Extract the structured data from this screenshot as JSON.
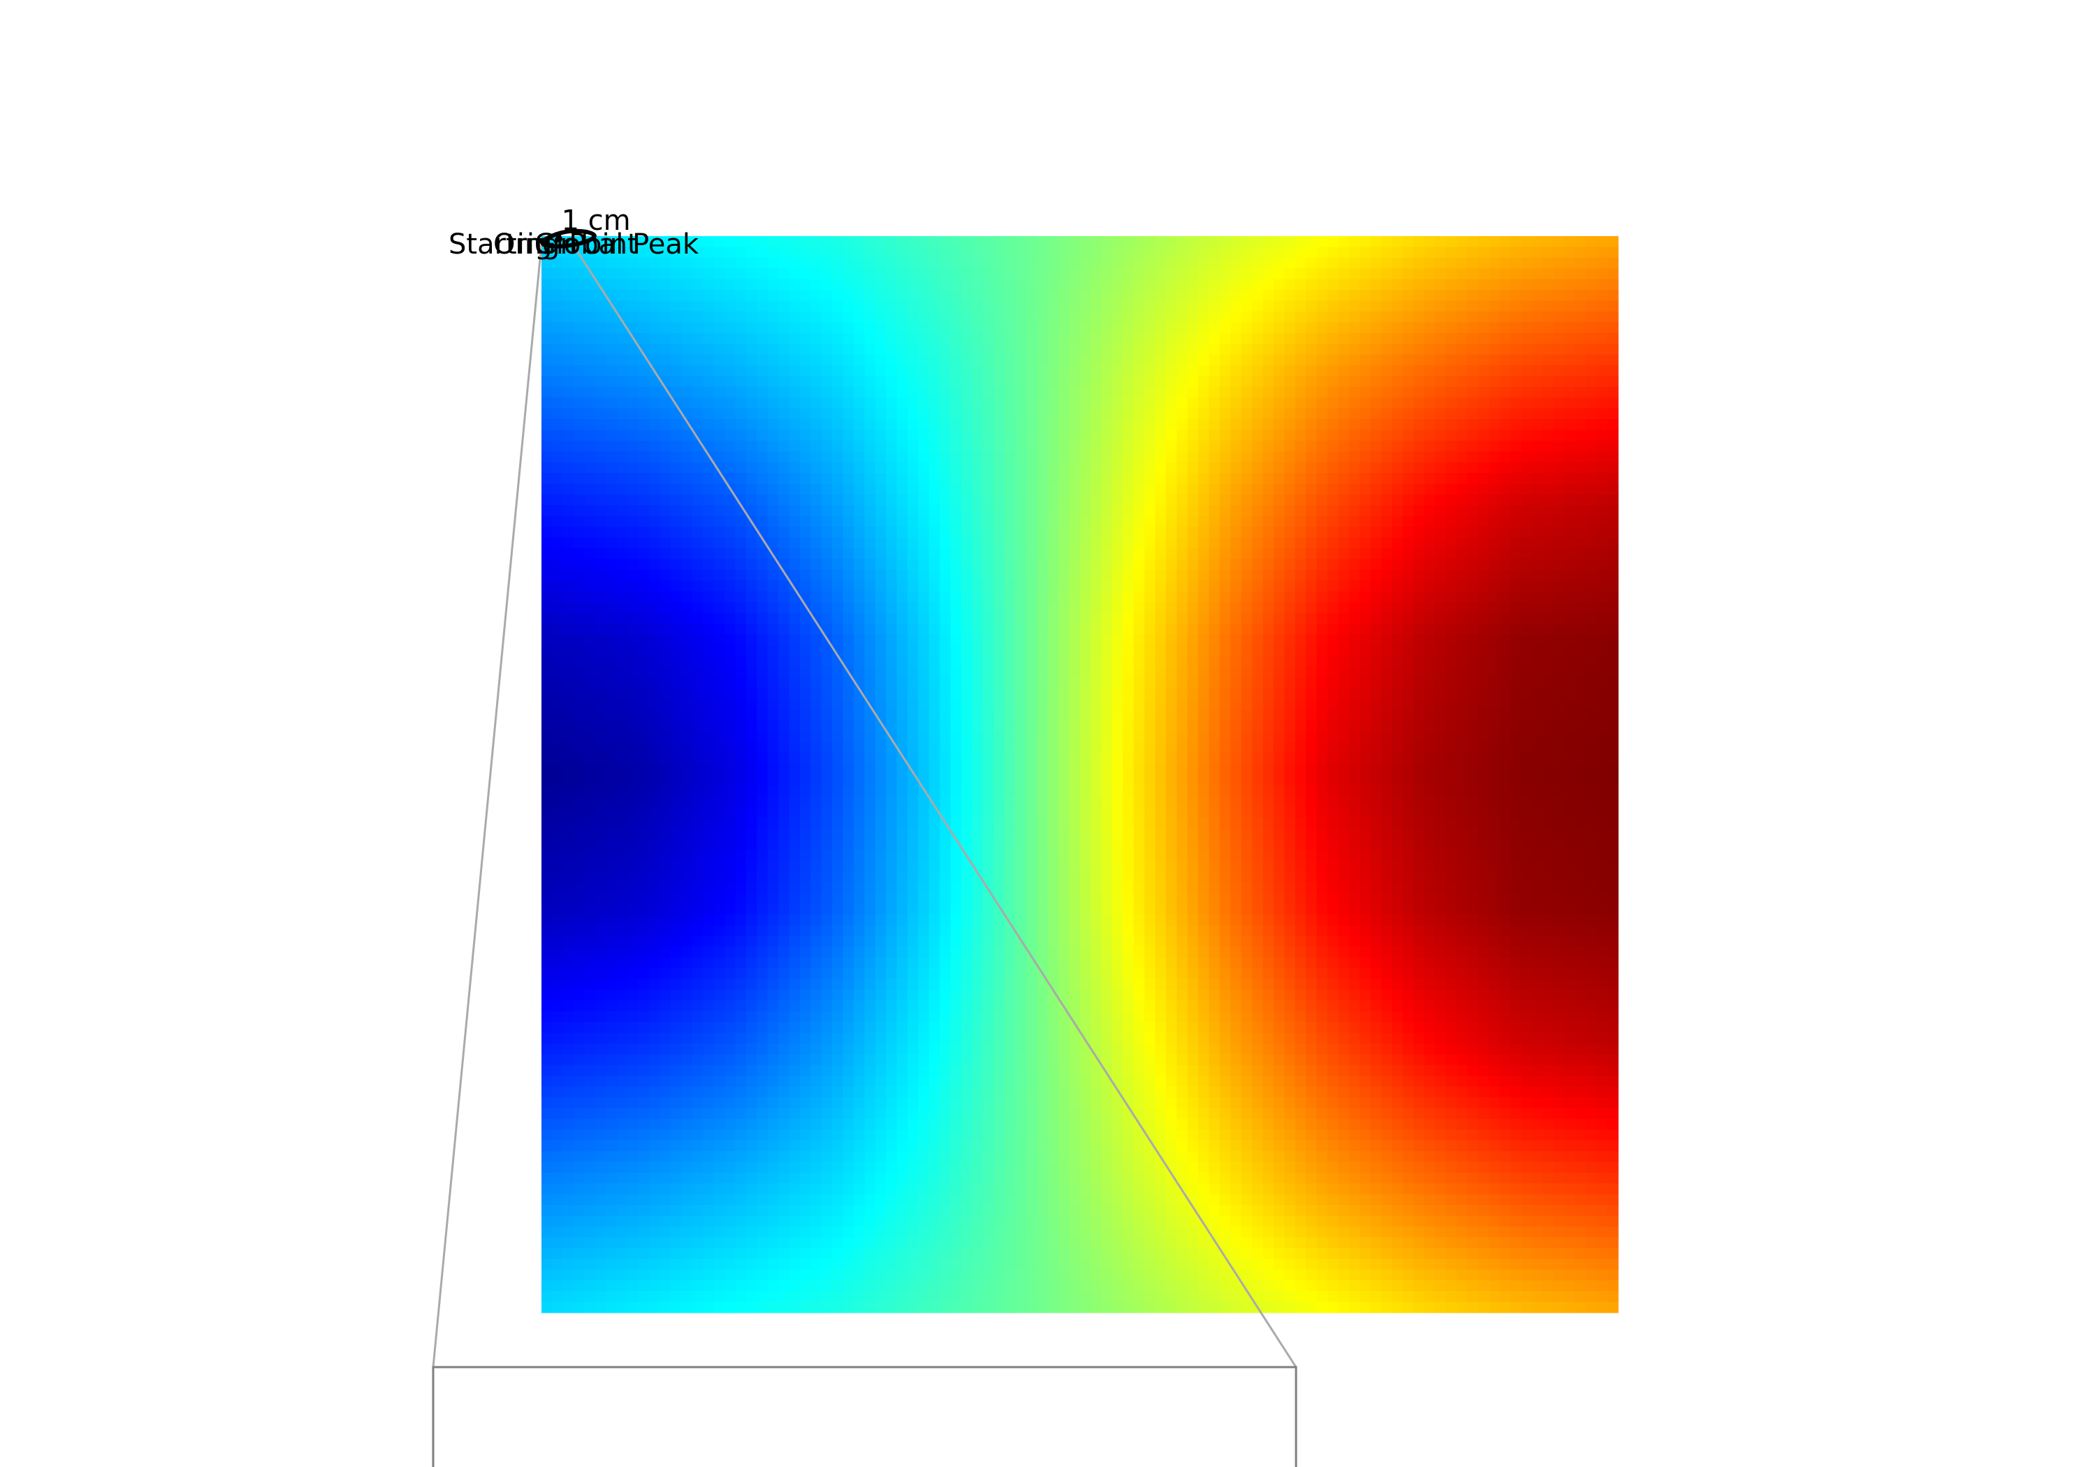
{
  "chart_data": {
    "type": "heatmap",
    "colormap": "jet",
    "grid": false,
    "axes_visible": false,
    "field": {
      "description_of_values": "normalized heatmap intensity in colormap units, 0 = dark blue, 1 = dark red",
      "samples": [
        [
          0.34,
          0.36,
          0.38,
          0.4,
          0.44,
          0.48,
          0.53,
          0.58,
          0.62,
          0.66,
          0.69,
          0.71
        ],
        [
          0.25,
          0.27,
          0.3,
          0.34,
          0.4,
          0.48,
          0.57,
          0.65,
          0.72,
          0.77,
          0.81,
          0.83
        ],
        [
          0.15,
          0.17,
          0.21,
          0.28,
          0.37,
          0.48,
          0.6,
          0.71,
          0.8,
          0.87,
          0.92,
          0.94
        ],
        [
          0.06,
          0.08,
          0.13,
          0.22,
          0.34,
          0.48,
          0.63,
          0.76,
          0.87,
          0.94,
          0.98,
          0.99
        ],
        [
          0.02,
          0.04,
          0.1,
          0.2,
          0.33,
          0.48,
          0.64,
          0.78,
          0.9,
          0.96,
          0.99,
          1.0
        ],
        [
          0.06,
          0.08,
          0.13,
          0.22,
          0.34,
          0.48,
          0.63,
          0.76,
          0.87,
          0.94,
          0.98,
          0.99
        ],
        [
          0.15,
          0.17,
          0.21,
          0.28,
          0.37,
          0.48,
          0.6,
          0.71,
          0.8,
          0.87,
          0.92,
          0.94
        ],
        [
          0.25,
          0.27,
          0.3,
          0.34,
          0.4,
          0.48,
          0.57,
          0.65,
          0.72,
          0.77,
          0.81,
          0.83
        ],
        [
          0.34,
          0.36,
          0.38,
          0.4,
          0.44,
          0.48,
          0.53,
          0.58,
          0.62,
          0.66,
          0.69,
          0.71
        ]
      ]
    },
    "scalebar": {
      "label": "1 cm"
    },
    "annotations": [
      {
        "text": "Starting Point"
      },
      {
        "text": "Global Peak"
      },
      {
        "text": "Origin"
      }
    ],
    "inset": {
      "type": "zoom-inset",
      "content_visible": false
    }
  },
  "colors": {
    "connector": "#aaaaaa",
    "inset_frame": "#808080",
    "path": "#000000"
  }
}
